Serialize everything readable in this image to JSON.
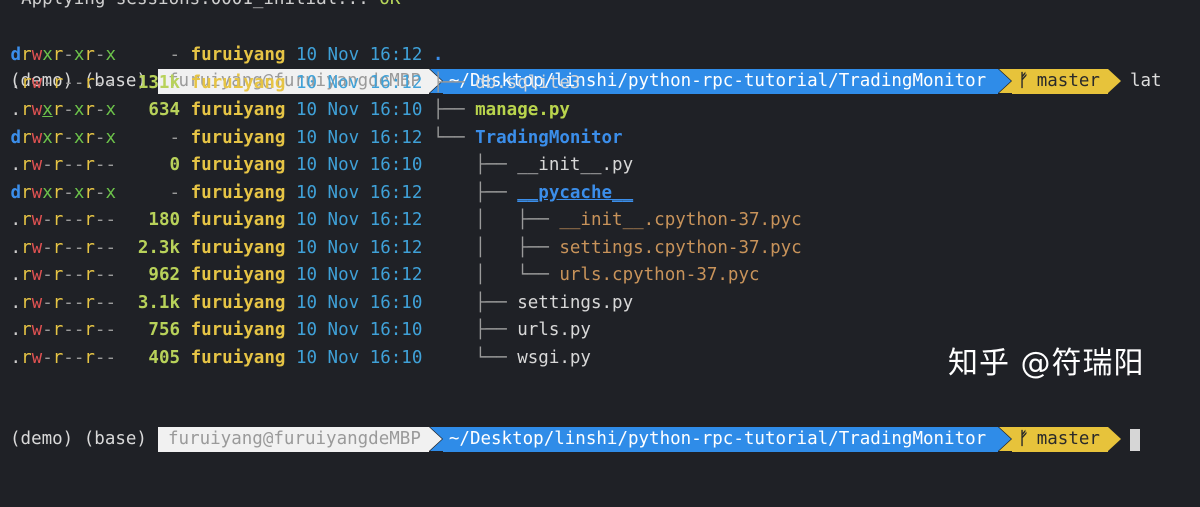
{
  "top_line": {
    "prefix": "  Applying sessions.0001_initial... ",
    "status": "OK"
  },
  "prompt_top": {
    "env": "(demo) (base)",
    "user_host": "furuiyang@furuiyangdeMBP",
    "path": "~/Desktop/linshi/python-rpc-tutorial/TradingMonitor",
    "branch": "master",
    "command": "lat"
  },
  "listing": [
    {
      "perm": "drwxr-xr-x",
      "size": "-",
      "owner": "furuiyang",
      "date": "10 Nov 16:12",
      "tree": "",
      "name": ".",
      "kind": "dir"
    },
    {
      "perm": ".rw-r--r--",
      "size": "131k",
      "owner": "furuiyang",
      "date": "10 Nov 16:12",
      "tree": "├── ",
      "name": "db.sqlite3",
      "kind": "file"
    },
    {
      "perm": ".rwxr-xr-x",
      "size": "634",
      "owner": "furuiyang",
      "date": "10 Nov 16:10",
      "tree": "├── ",
      "name": "manage.py",
      "kind": "exec"
    },
    {
      "perm": "drwxr-xr-x",
      "size": "-",
      "owner": "furuiyang",
      "date": "10 Nov 16:12",
      "tree": "└── ",
      "name": "TradingMonitor",
      "kind": "dir"
    },
    {
      "perm": ".rw-r--r--",
      "size": "0",
      "owner": "furuiyang",
      "date": "10 Nov 16:10",
      "tree": "    ├── ",
      "name": "__init__.py",
      "kind": "file"
    },
    {
      "perm": "drwxr-xr-x",
      "size": "-",
      "owner": "furuiyang",
      "date": "10 Nov 16:12",
      "tree": "    ├── ",
      "name": "__pycache__",
      "kind": "dir"
    },
    {
      "perm": ".rw-r--r--",
      "size": "180",
      "owner": "furuiyang",
      "date": "10 Nov 16:12",
      "tree": "    │   ├── ",
      "name": "__init__.cpython-37.pyc",
      "kind": "pyc"
    },
    {
      "perm": ".rw-r--r--",
      "size": "2.3k",
      "owner": "furuiyang",
      "date": "10 Nov 16:12",
      "tree": "    │   ├── ",
      "name": "settings.cpython-37.pyc",
      "kind": "pyc"
    },
    {
      "perm": ".rw-r--r--",
      "size": "962",
      "owner": "furuiyang",
      "date": "10 Nov 16:12",
      "tree": "    │   └── ",
      "name": "urls.cpython-37.pyc",
      "kind": "pyc"
    },
    {
      "perm": ".rw-r--r--",
      "size": "3.1k",
      "owner": "furuiyang",
      "date": "10 Nov 16:10",
      "tree": "    ├── ",
      "name": "settings.py",
      "kind": "file"
    },
    {
      "perm": ".rw-r--r--",
      "size": "756",
      "owner": "furuiyang",
      "date": "10 Nov 16:10",
      "tree": "    ├── ",
      "name": "urls.py",
      "kind": "file"
    },
    {
      "perm": ".rw-r--r--",
      "size": "405",
      "owner": "furuiyang",
      "date": "10 Nov 16:10",
      "tree": "    └── ",
      "name": "wsgi.py",
      "kind": "file"
    }
  ],
  "prompt_bottom": {
    "env": "(demo) (base)",
    "user_host": "furuiyang@furuiyangdeMBP",
    "path": "~/Desktop/linshi/python-rpc-tutorial/TradingMonitor",
    "branch": "master"
  },
  "watermark": "知乎 @符瑞阳",
  "colors": {
    "background": "#1f2126",
    "path_segment": "#2f8ce8",
    "git_segment": "#e7c33b",
    "user_segment": "#f1f1f1",
    "directory": "#3b8eea",
    "owner": "#e6c445",
    "size": "#b8d25a",
    "date": "#3fa1d8"
  }
}
